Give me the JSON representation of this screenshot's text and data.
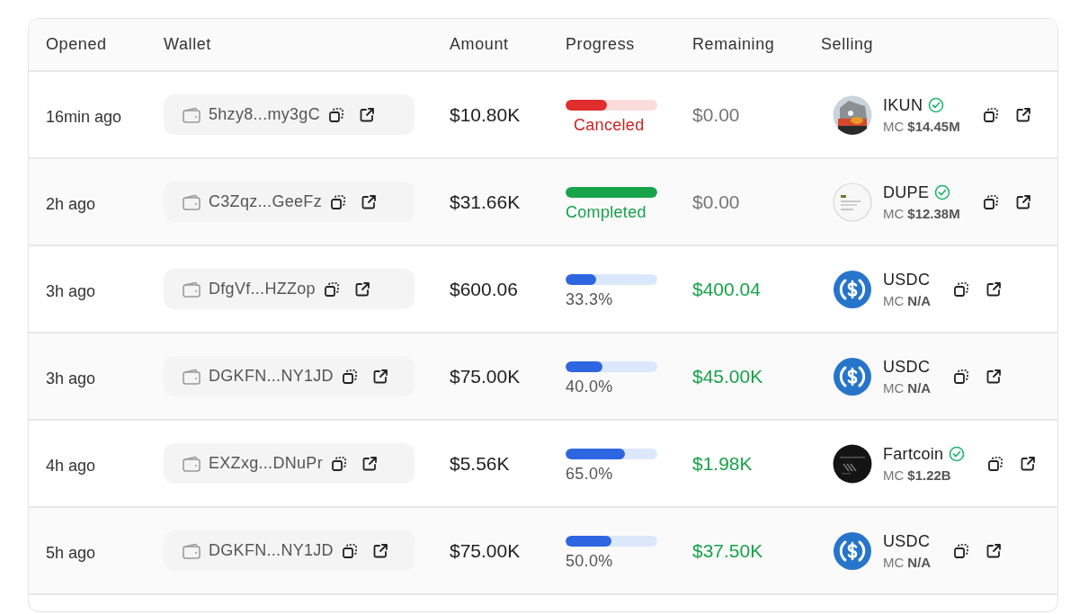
{
  "table": {
    "columns": [
      "Opened",
      "Wallet",
      "Amount",
      "Progress",
      "Remaining",
      "Selling"
    ],
    "rows": [
      {
        "opened": "16min ago",
        "wallet": "5hzy8...my3gC",
        "amount": "$10.80K",
        "progress": {
          "kind": "canceled",
          "level": 0.45,
          "label": "Canceled"
        },
        "remaining": {
          "text": "$0.00",
          "highlighted": false
        },
        "token": {
          "name": "IKUN",
          "verified": true,
          "kind": "picture",
          "mc_label": "MC",
          "mc": "$14.45M"
        }
      },
      {
        "opened": "2h ago",
        "wallet": "C3Zqz...GeeFz",
        "amount": "$31.66K",
        "progress": {
          "kind": "completed",
          "level": 1,
          "label": "Completed"
        },
        "remaining": {
          "text": "$0.00",
          "highlighted": false
        },
        "token": {
          "name": "DUPE",
          "verified": true,
          "kind": "picture",
          "mc_label": "MC",
          "mc": "$12.38M"
        }
      },
      {
        "opened": "3h ago",
        "wallet": "DfgVf...HZZop",
        "amount": "$600.06",
        "progress": {
          "kind": "partial",
          "level": 0.333,
          "label": "33.3%"
        },
        "remaining": {
          "text": "$400.04",
          "highlighted": true
        },
        "token": {
          "name": "USDC",
          "verified": false,
          "kind": "usdc",
          "mc_label": "MC",
          "mc": "N/A"
        }
      },
      {
        "opened": "3h ago",
        "wallet": "DGKFN...NY1JD",
        "amount": "$75.00K",
        "progress": {
          "kind": "partial",
          "level": 0.4,
          "label": "40.0%"
        },
        "remaining": {
          "text": "$45.00K",
          "highlighted": true
        },
        "token": {
          "name": "USDC",
          "verified": false,
          "kind": "usdc",
          "mc_label": "MC",
          "mc": "N/A"
        }
      },
      {
        "opened": "4h ago",
        "wallet": "EXZxg...DNuPr",
        "amount": "$5.56K",
        "progress": {
          "kind": "partial",
          "level": 0.65,
          "label": "65.0%"
        },
        "remaining": {
          "text": "$1.98K",
          "highlighted": true
        },
        "token": {
          "name": "Fartcoin",
          "verified": true,
          "kind": "picture",
          "mc_label": "MC",
          "mc": "$1.22B"
        }
      },
      {
        "opened": "5h ago",
        "wallet": "DGKFN...NY1JD",
        "amount": "$75.00K",
        "progress": {
          "kind": "partial",
          "level": 0.5,
          "label": "50.0%"
        },
        "remaining": {
          "text": "$37.50K",
          "highlighted": true
        },
        "token": {
          "name": "USDC",
          "verified": false,
          "kind": "usdc",
          "mc_label": "MC",
          "mc": "N/A"
        }
      }
    ]
  }
}
